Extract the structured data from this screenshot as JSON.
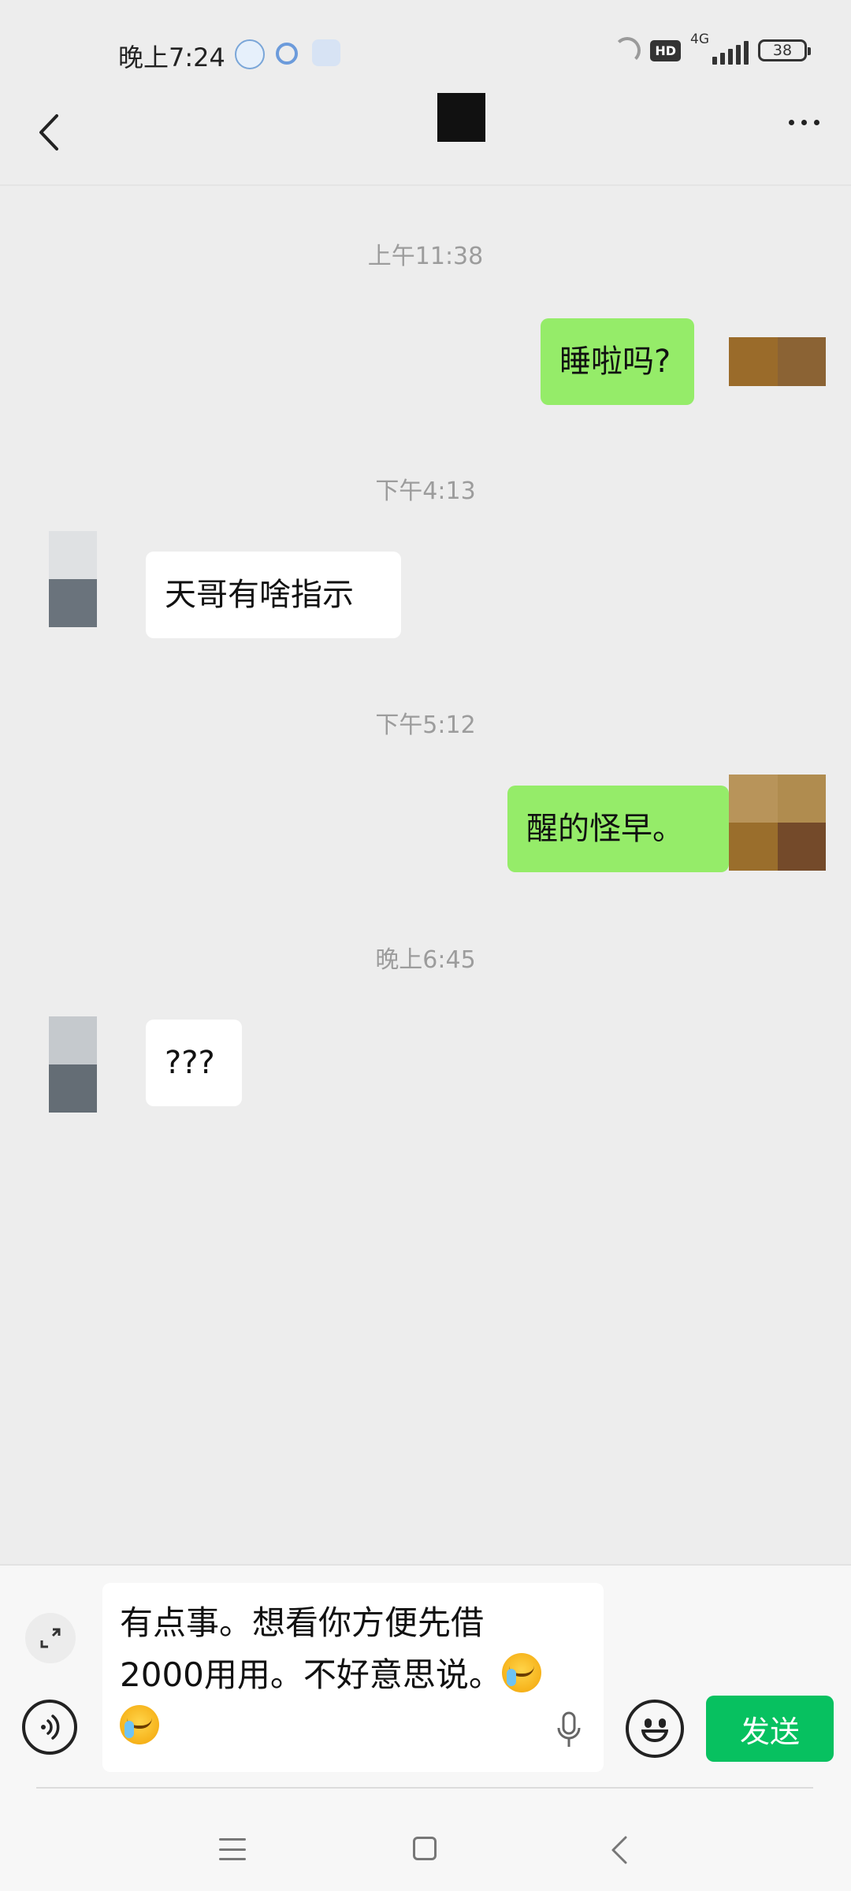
{
  "status_bar": {
    "time": "晚上7:24",
    "network": "4G",
    "hd_label": "HD",
    "battery": "38",
    "icons": [
      "message-bubble-icon",
      "q-app-icon",
      "blurred-notification-icon",
      "nfc-icon",
      "hd-icon",
      "signal-icon",
      "battery-icon"
    ]
  },
  "header": {
    "back_icon": "chevron-left-icon",
    "more_icon": "more-dots-icon"
  },
  "messages": [
    {
      "type": "timestamp",
      "text": "上午11:38"
    },
    {
      "type": "outgoing",
      "text": "睡啦吗?"
    },
    {
      "type": "timestamp",
      "text": "下午4:13"
    },
    {
      "type": "incoming",
      "text": "天哥有啥指示"
    },
    {
      "type": "timestamp",
      "text": "下午5:12"
    },
    {
      "type": "outgoing",
      "text": "醒的怪早。"
    },
    {
      "type": "timestamp",
      "text": "晚上6:45"
    },
    {
      "type": "incoming",
      "text": "???"
    }
  ],
  "input": {
    "text": "有点事。想看你方便先借2000用用。不好意思说。",
    "text_line1": "有点事。想看你方便先借",
    "text_line2": "2000用用。不好意思说。",
    "emoji": "cry-laugh-emoji",
    "send_label": "发送",
    "send_color": "#07c160"
  },
  "colors": {
    "background": "#ededed",
    "outgoing_bubble": "#95ec69",
    "incoming_bubble": "#ffffff"
  },
  "navbar": {
    "icons": [
      "menu-icon",
      "home-icon",
      "back-icon"
    ]
  }
}
